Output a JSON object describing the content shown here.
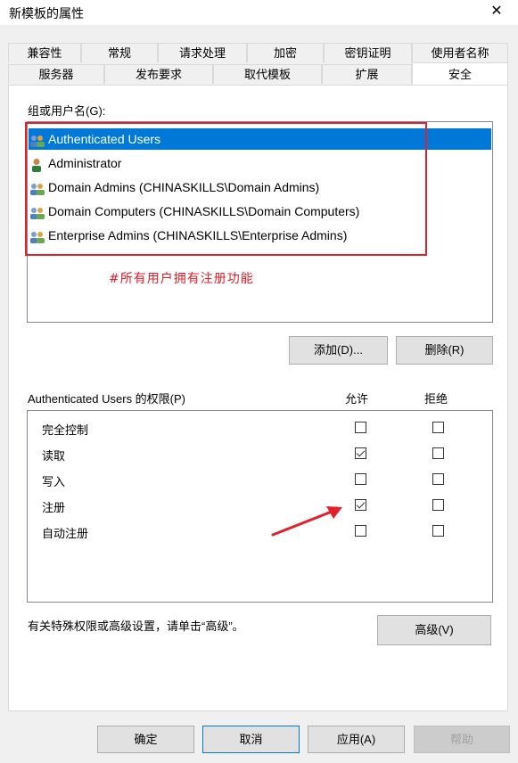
{
  "dialog": {
    "title": "新模板的属性",
    "close": "✕"
  },
  "tabs_row1": [
    "兼容性",
    "常规",
    "请求处理",
    "加密",
    "密钥证明",
    "使用者名称"
  ],
  "tabs_row2": [
    "服务器",
    "发布要求",
    "取代模板",
    "扩展",
    "安全"
  ],
  "groups": {
    "label": "组或用户名(G):",
    "items": [
      {
        "name": "Authenticated Users",
        "icon": "group-icon"
      },
      {
        "name": "Administrator",
        "icon": "user-icon"
      },
      {
        "name": "Domain Admins (CHINASKILLS\\Domain Admins)",
        "icon": "group-icon"
      },
      {
        "name": "Domain Computers (CHINASKILLS\\Domain Computers)",
        "icon": "group-icon"
      },
      {
        "name": "Enterprise Admins (CHINASKILLS\\Enterprise Admins)",
        "icon": "group-icon"
      }
    ],
    "note": "#所有用户拥有注册功能"
  },
  "buttons": {
    "add": "添加(D)...",
    "remove": "删除(R)",
    "advanced": "高级(V)",
    "ok": "确定",
    "cancel": "取消",
    "apply": "应用(A)",
    "help": "帮助"
  },
  "permissions": {
    "label": "Authenticated Users 的权限(P)",
    "allow_header": "允许",
    "deny_header": "拒绝",
    "rows": [
      {
        "name": "完全控制",
        "allow": false,
        "deny": false
      },
      {
        "name": "读取",
        "allow": true,
        "deny": false
      },
      {
        "name": "写入",
        "allow": false,
        "deny": false
      },
      {
        "name": "注册",
        "allow": true,
        "deny": false
      },
      {
        "name": "自动注册",
        "allow": false,
        "deny": false
      }
    ]
  },
  "advanced_hint": "有关特殊权限或高级设置，请单击“高级”。",
  "colors": {
    "selection": "#0078d7",
    "annotation": "#e0202a"
  }
}
